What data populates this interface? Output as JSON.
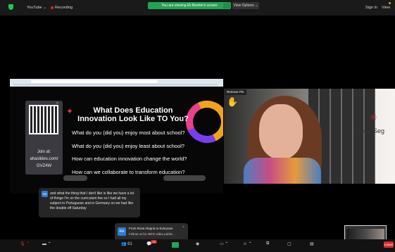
{
  "topbar": {
    "app_menu": "YouTube ⌄",
    "recording": "Recording",
    "banner": "You are viewing Eli Boehm's screen",
    "view_options": "View Options ⌄",
    "sign_in": "Sign In",
    "view": "View"
  },
  "slide": {
    "title_line1": "What Does Education",
    "title_line2": "Innovation Look Like TO You?",
    "q1": "What do you (did you) enjoy most about school?",
    "q2": "What do you (did you) enjoy least about school?",
    "q3": "How can education innovation change the world?",
    "q4": "How can we collaborate to transform education?",
    "join_label": "Join at:",
    "join_site": "ahaslides.com/",
    "join_code": "GVZ4W"
  },
  "video": {
    "remove_pin": "Remove Pin",
    "porto_name": "Porto Seg"
  },
  "caption": {
    "avatar": "EB",
    "text": "and what the thing that I don't like is like we have a lot of things I'm on the curriculum fee so I had all my subject in Portuguese and in Germany so we had like the double off Saturday"
  },
  "toast": {
    "avatar": "RA",
    "from": "From Rosa Alegria to Everyone",
    "message": "Follow us for WFD video public...",
    "close": "×"
  },
  "toolbar": {
    "participants_count": "61",
    "chat_badge": "19",
    "leave": "Leave"
  },
  "colors": {
    "green": "#23a455",
    "red": "#e02828",
    "bg": "#000000"
  }
}
